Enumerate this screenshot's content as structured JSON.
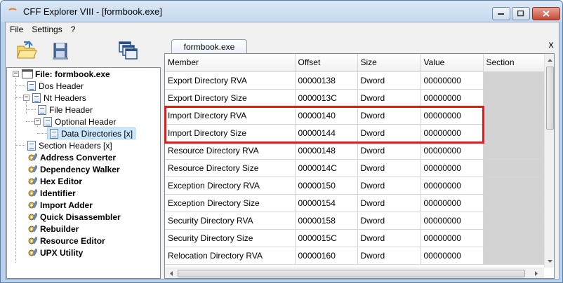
{
  "window": {
    "title": "CFF Explorer VIII - [formbook.exe]",
    "accent": "#e11b1b"
  },
  "menu": [
    "File",
    "Settings",
    "?"
  ],
  "toolbar": {
    "icons": [
      "open-folder-icon",
      "save-disk-icon",
      "windows-icon"
    ]
  },
  "tree": {
    "root": "File: formbook.exe",
    "dos_header": "Dos Header",
    "nt_headers": "Nt Headers",
    "file_header": "File Header",
    "optional_header": "Optional Header",
    "data_directories": "Data Directories [x]",
    "section_headers": "Section Headers [x]",
    "tools": [
      "Address Converter",
      "Dependency Walker",
      "Hex Editor",
      "Identifier",
      "Import Adder",
      "Quick Disassembler",
      "Rebuilder",
      "Resource Editor",
      "UPX Utility"
    ]
  },
  "tab": {
    "label": "formbook.exe",
    "close": "x"
  },
  "grid": {
    "columns": [
      "Member",
      "Offset",
      "Size",
      "Value",
      "Section"
    ],
    "rows": [
      [
        "Export Directory RVA",
        "00000138",
        "Dword",
        "00000000",
        ""
      ],
      [
        "Export Directory Size",
        "0000013C",
        "Dword",
        "00000000",
        ""
      ],
      [
        "Import Directory RVA",
        "00000140",
        "Dword",
        "00000000",
        ""
      ],
      [
        "Import Directory Size",
        "00000144",
        "Dword",
        "00000000",
        ""
      ],
      [
        "Resource Directory RVA",
        "00000148",
        "Dword",
        "00000000",
        ""
      ],
      [
        "Resource Directory Size",
        "0000014C",
        "Dword",
        "00000000",
        ""
      ],
      [
        "Exception Directory RVA",
        "00000150",
        "Dword",
        "00000000",
        ""
      ],
      [
        "Exception Directory Size",
        "00000154",
        "Dword",
        "00000000",
        ""
      ],
      [
        "Security Directory RVA",
        "00000158",
        "Dword",
        "00000000",
        ""
      ],
      [
        "Security Directory Size",
        "0000015C",
        "Dword",
        "00000000",
        ""
      ],
      [
        "Relocation Directory RVA",
        "00000160",
        "Dword",
        "00000000",
        ""
      ]
    ]
  }
}
